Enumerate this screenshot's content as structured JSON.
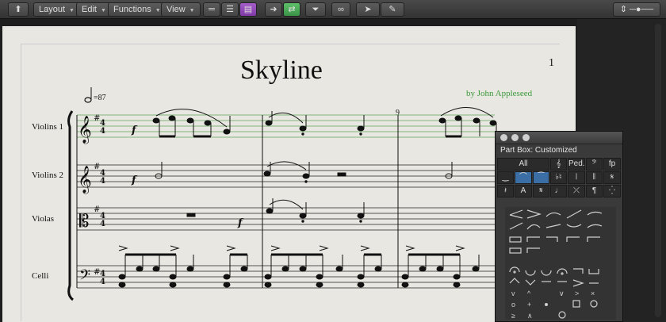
{
  "toolbar": {
    "menus": [
      "Layout",
      "Edit",
      "Functions",
      "View"
    ]
  },
  "score": {
    "title": "Skyline",
    "page_number": "1",
    "composer": "by John Appleseed",
    "tempo": "=87",
    "measure_number": "9",
    "instruments": [
      "Violins 1",
      "Violins 2",
      "Violas",
      "Celli"
    ],
    "time_signature": "4/4",
    "dynamic": "f"
  },
  "part_box": {
    "title": "Part Box: Customized",
    "all_label": "All",
    "row1": [
      "𝄞",
      "Ped.",
      "𝄢",
      "fp"
    ],
    "row2": [
      "‿",
      "⁀",
      "♭♮",
      "𝄃",
      "𝄋"
    ],
    "row3": [
      "𝄽",
      "A",
      "𝄋",
      "♩",
      "⤫",
      "¶",
      "⁛"
    ]
  }
}
